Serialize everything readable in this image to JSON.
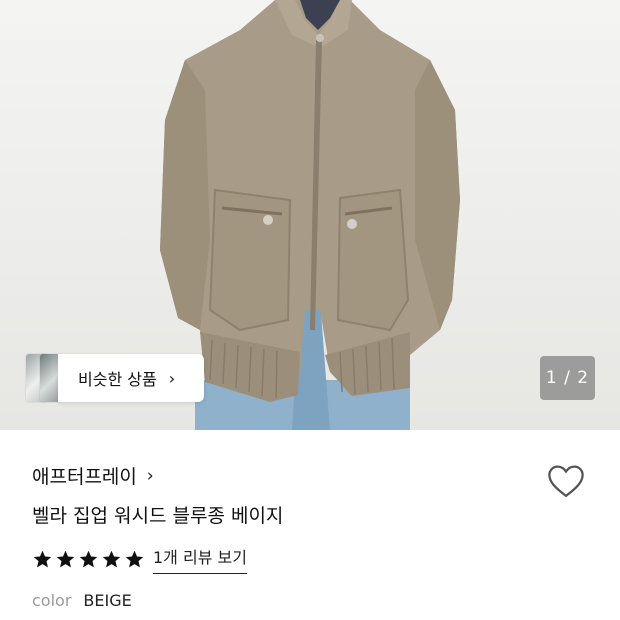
{
  "gallery": {
    "image_alt": "jacket-photo",
    "current": "1 / 2",
    "similar_label": "비슷한 상품",
    "similar_chevron": "›"
  },
  "product": {
    "brand": "애프터프레이",
    "brand_chevron": "›",
    "title": "벨라 집업 워시드 블루종 베이지",
    "rating": {
      "stars": 5,
      "review_link": "1개 리뷰 보기"
    },
    "color": {
      "label": "color",
      "value": "BEIGE"
    }
  },
  "colors": {
    "jacket": "#a89c88",
    "denim": "#8fb1cc",
    "accent": "#111111"
  },
  "icons": {
    "wishlist": "heart-outline-icon",
    "rating": "star-icon"
  }
}
